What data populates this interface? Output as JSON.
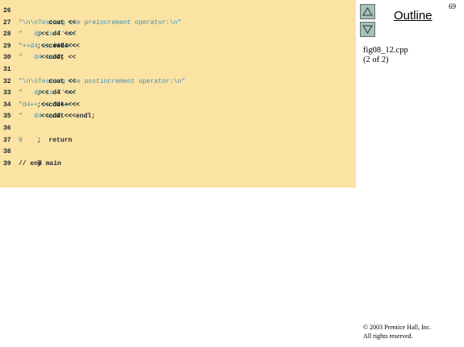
{
  "code": {
    "lines": [
      {
        "num": "26",
        "parts": []
      },
      {
        "num": "27",
        "parts": [
          {
            "t": "   cout << ",
            "c": "code"
          },
          {
            "t": "\"\\n\\nTesting the preincrement operator:\\n\"",
            "c": "str"
          }
        ]
      },
      {
        "num": "28",
        "parts": [
          {
            "t": "        << ",
            "c": "code"
          },
          {
            "t": "\"   d4 is \"",
            "c": "str"
          },
          {
            "t": " << d4 << ",
            "c": "code"
          },
          {
            "t": "'\\n'",
            "c": "str"
          },
          {
            "t": ";",
            "c": "code"
          }
        ]
      },
      {
        "num": "29",
        "parts": [
          {
            "t": "   cout << ",
            "c": "code"
          },
          {
            "t": "\"++d4 is \"",
            "c": "str"
          },
          {
            "t": " << ++d4 << ",
            "c": "code"
          },
          {
            "t": "'\\n'",
            "c": "str"
          },
          {
            "t": ";",
            "c": "code"
          }
        ]
      },
      {
        "num": "30",
        "parts": [
          {
            "t": "   cout << ",
            "c": "code"
          },
          {
            "t": "\"   d4 is \"",
            "c": "str"
          },
          {
            "t": " << d4;",
            "c": "code"
          }
        ]
      },
      {
        "num": "31",
        "parts": []
      },
      {
        "num": "32",
        "parts": [
          {
            "t": "   cout << ",
            "c": "code"
          },
          {
            "t": "\"\\n\\nTesting the postincrement operator:\\n\"",
            "c": "str"
          }
        ]
      },
      {
        "num": "33",
        "parts": [
          {
            "t": "        << ",
            "c": "code"
          },
          {
            "t": "\"   d4 is \"",
            "c": "str"
          },
          {
            "t": " << d4 << ",
            "c": "code"
          },
          {
            "t": "'\\n'",
            "c": "str"
          },
          {
            "t": ";",
            "c": "code"
          }
        ]
      },
      {
        "num": "34",
        "parts": [
          {
            "t": "   cout << ",
            "c": "code"
          },
          {
            "t": "\"d4++ is \"",
            "c": "str"
          },
          {
            "t": " << d4++ << ",
            "c": "code"
          },
          {
            "t": "'\\n'",
            "c": "str"
          },
          {
            "t": ";",
            "c": "code"
          }
        ]
      },
      {
        "num": "35",
        "parts": [
          {
            "t": "   cout << ",
            "c": "code"
          },
          {
            "t": "\"   d4 is \"",
            "c": "str"
          },
          {
            "t": " << d4 << endl;",
            "c": "code"
          }
        ]
      },
      {
        "num": "36",
        "parts": []
      },
      {
        "num": "37",
        "parts": [
          {
            "t": "   return ",
            "c": "code"
          },
          {
            "t": "0",
            "c": "str"
          },
          {
            "t": ";",
            "c": "code"
          }
        ]
      },
      {
        "num": "38",
        "parts": []
      },
      {
        "num": "39",
        "parts": [
          {
            "t": "} ",
            "c": "code"
          },
          {
            "t": "// end main",
            "c": "cmt"
          }
        ]
      }
    ]
  },
  "sidebar": {
    "outline_label": "Outline",
    "file_name": "fig08_12.cpp",
    "page_info": "(2 of 2)",
    "up_icon": "triangle-up-icon",
    "down_icon": "triangle-down-icon"
  },
  "page_number": "69",
  "footer": {
    "line1": "© 2003 Prentice Hall, Inc.",
    "line2": "All rights reserved."
  }
}
